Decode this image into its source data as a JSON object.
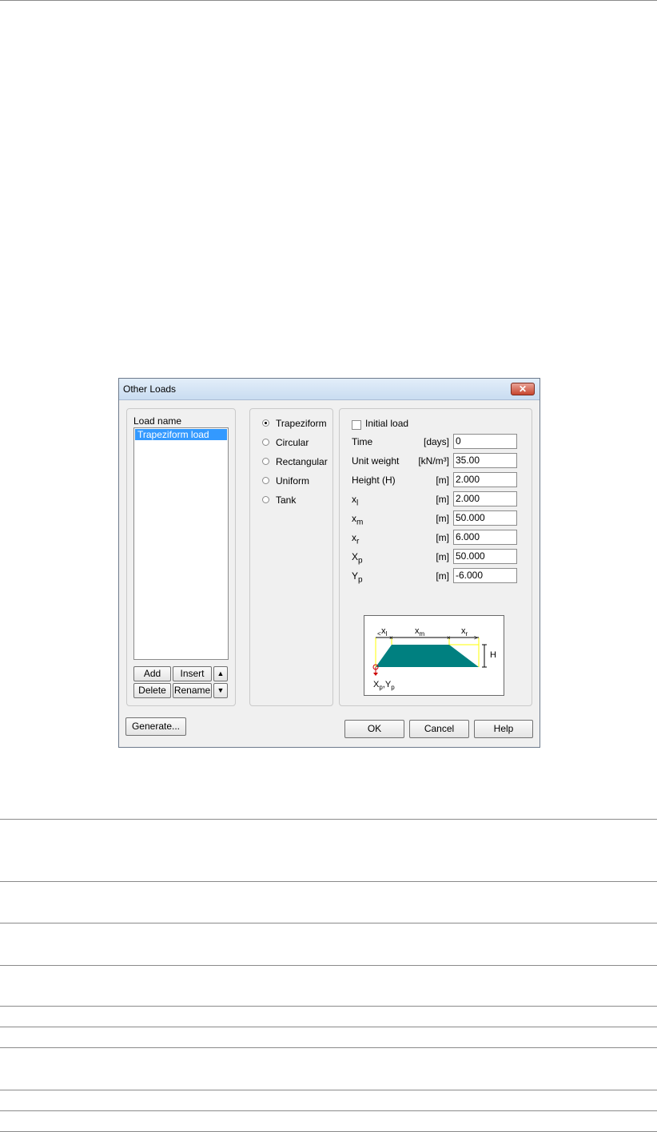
{
  "dialog": {
    "title": "Other Loads",
    "close_glyph": "✕",
    "load_name_label": "Load name",
    "load_list": [
      "Trapeziform load"
    ],
    "list_buttons": {
      "add": "Add",
      "insert": "Insert",
      "delete": "Delete",
      "rename": "Rename",
      "up": "▲",
      "down": "▼"
    },
    "load_types": [
      {
        "label": "Trapeziform",
        "selected": true
      },
      {
        "label": "Circular",
        "selected": false
      },
      {
        "label": "Rectangular",
        "selected": false
      },
      {
        "label": "Uniform",
        "selected": false
      },
      {
        "label": "Tank",
        "selected": false
      }
    ],
    "initial_load": {
      "label": "Initial load",
      "checked": false
    },
    "params": [
      {
        "name": "Time",
        "unit": "[days]",
        "value": "0"
      },
      {
        "name": "Unit weight",
        "unit": "[kN/m³]",
        "value": "35.00"
      },
      {
        "name": "Height (H)",
        "unit": "[m]",
        "value": "2.000"
      },
      {
        "name": "x",
        "sub": "l",
        "unit": "[m]",
        "value": "2.000"
      },
      {
        "name": "x",
        "sub": "m",
        "unit": "[m]",
        "value": "50.000"
      },
      {
        "name": "x",
        "sub": "r",
        "unit": "[m]",
        "value": "6.000"
      },
      {
        "name": "X",
        "sub": "p",
        "unit": "[m]",
        "value": "50.000"
      },
      {
        "name": "Y",
        "sub": "p",
        "unit": "[m]",
        "value": "-6.000"
      }
    ],
    "diagram": {
      "labels": {
        "xl": "x",
        "xl_sub": "l",
        "xm": "x",
        "xm_sub": "m",
        "xr": "x",
        "xr_sub": "r",
        "h": "H",
        "origin": "X",
        "origin_sub1": "p",
        "origin_mid": ",Y",
        "origin_sub2": "p"
      },
      "fill_color": "#008080",
      "guide_color": "#ffff00",
      "origin_color": "#cc0000"
    },
    "bottom_buttons": {
      "generate": "Generate...",
      "ok": "OK",
      "cancel": "Cancel",
      "help": "Help"
    }
  }
}
